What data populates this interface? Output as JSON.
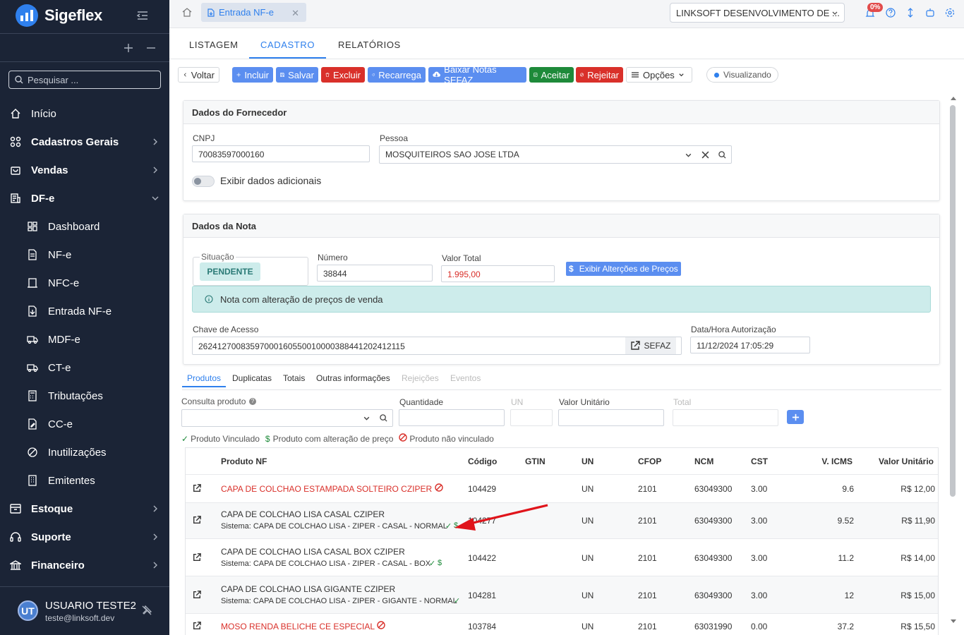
{
  "app": {
    "brand": "Sigeflex"
  },
  "sidebar": {
    "search_placeholder": "Pesquisar ...",
    "items": [
      {
        "label": "Início",
        "icon": "home-icon"
      },
      {
        "label": "Cadastros Gerais",
        "icon": "grid-icon"
      },
      {
        "label": "Vendas",
        "icon": "bag-icon"
      },
      {
        "label": "DF-e",
        "icon": "receipt-icon"
      },
      {
        "label": "Dashboard",
        "icon": "dashboard-icon"
      },
      {
        "label": "NF-e",
        "icon": "document-icon"
      },
      {
        "label": "NFC-e",
        "icon": "receipt-small-icon"
      },
      {
        "label": "Entrada NF-e",
        "icon": "document-in-icon"
      },
      {
        "label": "MDF-e",
        "icon": "truck-icon"
      },
      {
        "label": "CT-e",
        "icon": "truck-icon"
      },
      {
        "label": "Tributações",
        "icon": "calculator-icon"
      },
      {
        "label": "CC-e",
        "icon": "edit-document-icon"
      },
      {
        "label": "Inutilizações",
        "icon": "ban-icon"
      },
      {
        "label": "Emitentes",
        "icon": "building-icon"
      },
      {
        "label": "Estoque",
        "icon": "box-icon"
      },
      {
        "label": "Suporte",
        "icon": "headset-icon"
      },
      {
        "label": "Financeiro",
        "icon": "bank-icon"
      }
    ],
    "user": {
      "initials": "UT",
      "name": "USUARIO TESTE2",
      "email": "teste@linksoft.dev"
    }
  },
  "topbar": {
    "open_tab": "Entrada NF-e",
    "company": "LINKSOFT DESENVOLVIMENTO DE ...",
    "notification_badge": "0%"
  },
  "page_tabs": [
    "LISTAGEM",
    "CADASTRO",
    "RELATÓRIOS"
  ],
  "toolbar": {
    "voltar": "Voltar",
    "incluir": "Incluir",
    "salvar": "Salvar",
    "excluir": "Excluir",
    "recarrega": "Recarrega",
    "baixar": "Baixar Notas SEFAZ",
    "aceitar": "Aceitar",
    "rejeitar": "Rejeitar",
    "opcoes": "Opções",
    "status": "Visualizando"
  },
  "fornecedor": {
    "title": "Dados do Fornecedor",
    "cnpj_label": "CNPJ",
    "cnpj": "70083597000160",
    "pessoa_label": "Pessoa",
    "pessoa": "MOSQUITEIROS SAO JOSE LTDA",
    "toggle_label": "Exibir dados adicionais",
    "toggle_on": false
  },
  "nota": {
    "title": "Dados da Nota",
    "situacao_label": "Situação",
    "situacao": "PENDENTE",
    "numero_label": "Número",
    "numero": "38844",
    "valor_label": "Valor Total",
    "valor": "1.995,00",
    "precos_button": "Exibir Alterções de Preços",
    "alert": "Nota com alteração de preços de venda",
    "chave_label": "Chave de Acesso",
    "chave": "26241270083597000160550010000388441202412115",
    "sefaz_button": "SEFAZ",
    "data_label": "Data/Hora Autorização",
    "data": "11/12/2024 17:05:29"
  },
  "detail_tabs": [
    {
      "label": "Produtos",
      "enabled": true
    },
    {
      "label": "Duplicatas",
      "enabled": true
    },
    {
      "label": "Totais",
      "enabled": true
    },
    {
      "label": "Outras informações",
      "enabled": true
    },
    {
      "label": "Rejeições",
      "enabled": false
    },
    {
      "label": "Eventos",
      "enabled": false
    }
  ],
  "consulta": {
    "produto_label": "Consulta produto",
    "quantidade_label": "Quantidade",
    "un_label": "UN",
    "valor_unit_label": "Valor Unitário",
    "total_label": "Total"
  },
  "legend": {
    "vinculado": "Produto Vinculado",
    "alteracao": "Produto com alteração de preço",
    "nao_vinculado": "Produto não vinculado"
  },
  "table": {
    "columns": [
      "Produto NF",
      "Código",
      "GTIN",
      "UN",
      "CFOP",
      "NCM",
      "CST",
      "V. ICMS",
      "Valor Unitário"
    ],
    "rows": [
      {
        "produto": "CAPA DE COLCHAO ESTAMPADA SOLTEIRO CZIPER",
        "sistema": "",
        "status": "nao_vinculado",
        "codigo": "104429",
        "gtin": "",
        "un": "UN",
        "cfop": "2101",
        "ncm": "63049300",
        "cst": "3.00",
        "vicms": "9.6",
        "valor": "R$ 12,00"
      },
      {
        "produto": "CAPA DE COLCHAO LISA CASAL CZIPER",
        "sistema": "Sistema: CAPA DE COLCHAO LISA - ZIPER - CASAL - NORMAL",
        "status": "alteracao",
        "codigo": "104277",
        "gtin": "",
        "un": "UN",
        "cfop": "2101",
        "ncm": "63049300",
        "cst": "3.00",
        "vicms": "9.52",
        "valor": "R$ 11,90"
      },
      {
        "produto": "CAPA DE COLCHAO LISA CASAL BOX CZIPER",
        "sistema": "Sistema: CAPA DE COLCHAO LISA - ZIPER - CASAL - BOX",
        "status": "alteracao",
        "codigo": "104422",
        "gtin": "",
        "un": "UN",
        "cfop": "2101",
        "ncm": "63049300",
        "cst": "3.00",
        "vicms": "11.2",
        "valor": "R$ 14,00"
      },
      {
        "produto": "CAPA DE COLCHAO LISA GIGANTE CZIPER",
        "sistema": "Sistema: CAPA DE COLCHAO LISA - ZIPER - GIGANTE - NORMAL",
        "status": "vinculado",
        "codigo": "104281",
        "gtin": "",
        "un": "UN",
        "cfop": "2101",
        "ncm": "63049300",
        "cst": "3.00",
        "vicms": "12",
        "valor": "R$ 15,00"
      },
      {
        "produto": "MOSO RENDA BELICHE CE ESPECIAL",
        "sistema": "",
        "status": "nao_vinculado",
        "codigo": "103784",
        "gtin": "",
        "un": "UN",
        "cfop": "2101",
        "ncm": "63031990",
        "cst": "0.00",
        "vicms": "37.2",
        "valor": "R$ 15,50"
      }
    ]
  },
  "colors": {
    "primary": "#2f80ed",
    "danger": "#d9302a",
    "success": "#1e8a3a",
    "sidebar": "#1b2436",
    "alert_bg": "#cdeceb"
  }
}
